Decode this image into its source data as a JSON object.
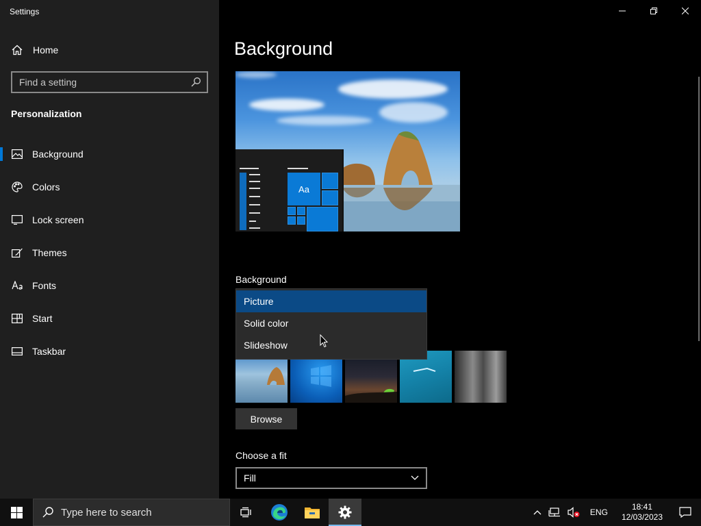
{
  "window": {
    "title": "Settings"
  },
  "sidebar": {
    "home_label": "Home",
    "search_placeholder": "Find a setting",
    "section_title": "Personalization",
    "items": [
      {
        "label": "Background",
        "icon": "picture-icon",
        "selected": true
      },
      {
        "label": "Colors",
        "icon": "palette-icon"
      },
      {
        "label": "Lock screen",
        "icon": "lock-screen-icon"
      },
      {
        "label": "Themes",
        "icon": "brush-icon"
      },
      {
        "label": "Fonts",
        "icon": "font-icon"
      },
      {
        "label": "Start",
        "icon": "start-icon"
      },
      {
        "label": "Taskbar",
        "icon": "taskbar-icon"
      }
    ]
  },
  "main": {
    "page_title": "Background",
    "preview": {
      "tile_text": "Aa"
    },
    "background_label": "Background",
    "background_dropdown": {
      "options": [
        "Picture",
        "Solid color",
        "Slideshow"
      ],
      "selected": "Picture"
    },
    "browse_label": "Browse",
    "fit_label": "Choose a fit",
    "fit_value": "Fill"
  },
  "taskbar": {
    "search_placeholder": "Type here to search",
    "language": "ENG",
    "time": "18:41",
    "date": "12/03/2023"
  },
  "colors": {
    "accent": "#0078d7",
    "sidebar_bg": "#1f1f1f",
    "selected_option": "#0b4a86",
    "taskbar_bg": "#101010"
  }
}
